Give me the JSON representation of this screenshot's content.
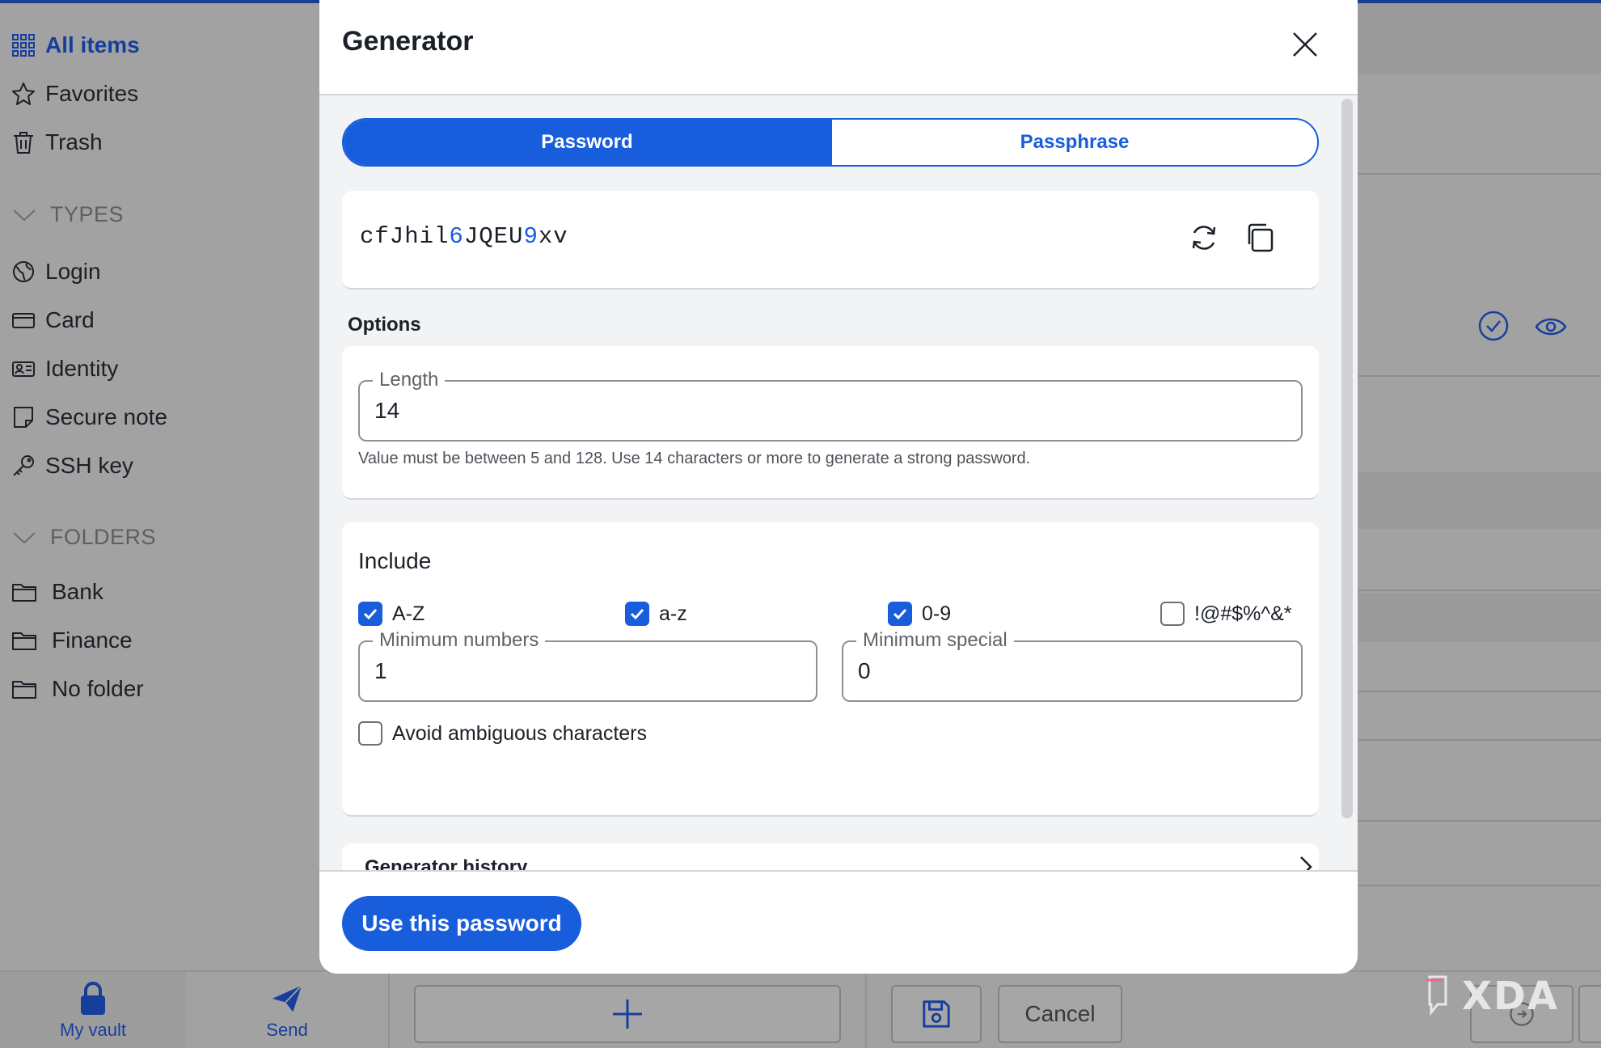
{
  "sidebar": {
    "items": [
      {
        "label": "All items",
        "icon": "grid-icon"
      },
      {
        "label": "Favorites",
        "icon": "star-icon"
      },
      {
        "label": "Trash",
        "icon": "trash-icon"
      }
    ],
    "types_heading": "TYPES",
    "types": [
      {
        "label": "Login",
        "icon": "globe-icon"
      },
      {
        "label": "Card",
        "icon": "credit-card-icon"
      },
      {
        "label": "Identity",
        "icon": "id-card-icon"
      },
      {
        "label": "Secure note",
        "icon": "note-icon"
      },
      {
        "label": "SSH key",
        "icon": "key-icon"
      }
    ],
    "folders_heading": "FOLDERS",
    "folders": [
      {
        "label": "Bank",
        "icon": "folder-icon"
      },
      {
        "label": "Finance",
        "icon": "folder-icon"
      },
      {
        "label": "No folder",
        "icon": "folder-icon"
      }
    ]
  },
  "bottom_bar": {
    "tabs": [
      {
        "label": "My vault",
        "icon": "lock-icon"
      },
      {
        "label": "Send",
        "icon": "paper-plane-icon"
      }
    ],
    "cancel_label": "Cancel"
  },
  "watermark": {
    "text": "XDA"
  },
  "modal": {
    "title": "Generator",
    "tabs": [
      {
        "label": "Password",
        "selected": true
      },
      {
        "label": "Passphrase",
        "selected": false
      }
    ],
    "password": {
      "segments": [
        {
          "text": "cfJhil",
          "numeric": false
        },
        {
          "text": "6",
          "numeric": true
        },
        {
          "text": "JQEU",
          "numeric": false
        },
        {
          "text": "9",
          "numeric": true
        },
        {
          "text": "xv",
          "numeric": false
        }
      ]
    },
    "options_heading": "Options",
    "length": {
      "label": "Length",
      "value": "14",
      "helper": "Value must be between 5 and 128. Use 14 characters or more to generate a strong password."
    },
    "include": {
      "heading": "Include",
      "checks": [
        {
          "label": "A-Z",
          "checked": true
        },
        {
          "label": "a-z",
          "checked": true
        },
        {
          "label": "0-9",
          "checked": true
        },
        {
          "label": "!@#$%^&*",
          "checked": false
        }
      ],
      "min_numbers": {
        "label": "Minimum numbers",
        "value": "1"
      },
      "min_special": {
        "label": "Minimum special",
        "value": "0"
      },
      "avoid_ambiguous": {
        "label": "Avoid ambiguous characters",
        "checked": false
      }
    },
    "history_label": "Generator history",
    "use_button": "Use this password"
  },
  "colors": {
    "accent": "#175ddc",
    "nav_active": "#173e9c",
    "overlay": "#a2a2a2"
  }
}
